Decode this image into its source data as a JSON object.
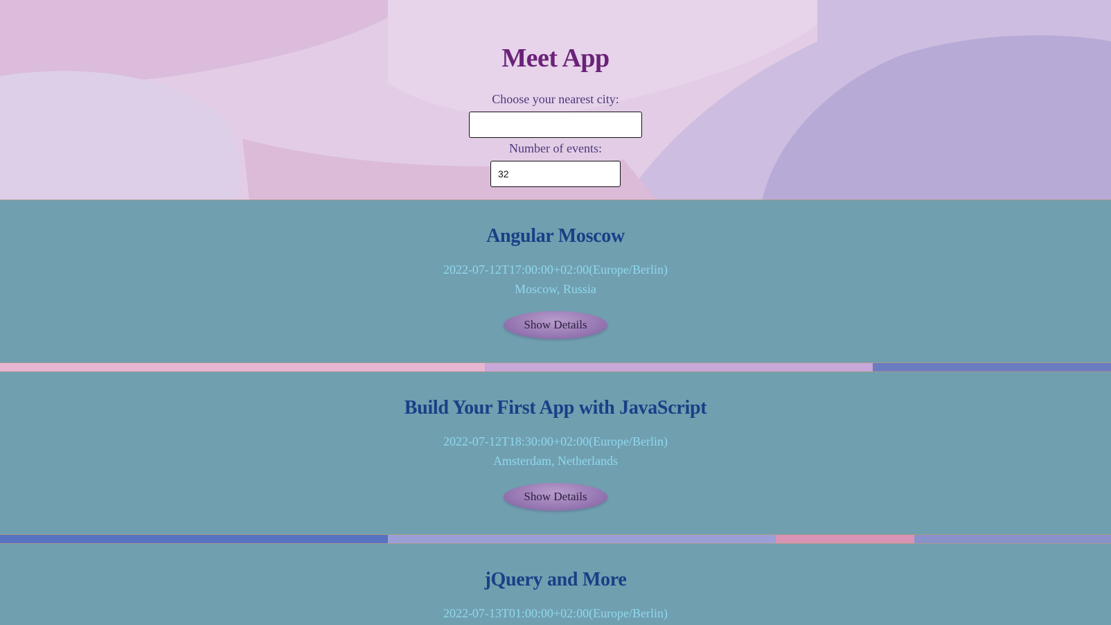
{
  "app": {
    "title": "Meet App"
  },
  "filters": {
    "city_label": "Choose your nearest city:",
    "city_value": "",
    "events_label": "Number of events:",
    "events_value": "32"
  },
  "events": [
    {
      "title": "Angular Moscow",
      "time": "2022-07-12T17:00:00+02:00(Europe/Berlin)",
      "location": "Moscow, Russia",
      "button_label": "Show Details"
    },
    {
      "title": "Build Your First App with JavaScript",
      "time": "2022-07-12T18:30:00+02:00(Europe/Berlin)",
      "location": "Amsterdam, Netherlands",
      "button_label": "Show Details"
    },
    {
      "title": "jQuery and More",
      "time": "2022-07-13T01:00:00+02:00(Europe/Berlin)"
    }
  ],
  "colors": {
    "title": "#6a2278",
    "card_background": "#709fb0",
    "event_title": "#1a3f86",
    "event_meta": "#8fd9ee",
    "button": "#9a7bb5"
  }
}
